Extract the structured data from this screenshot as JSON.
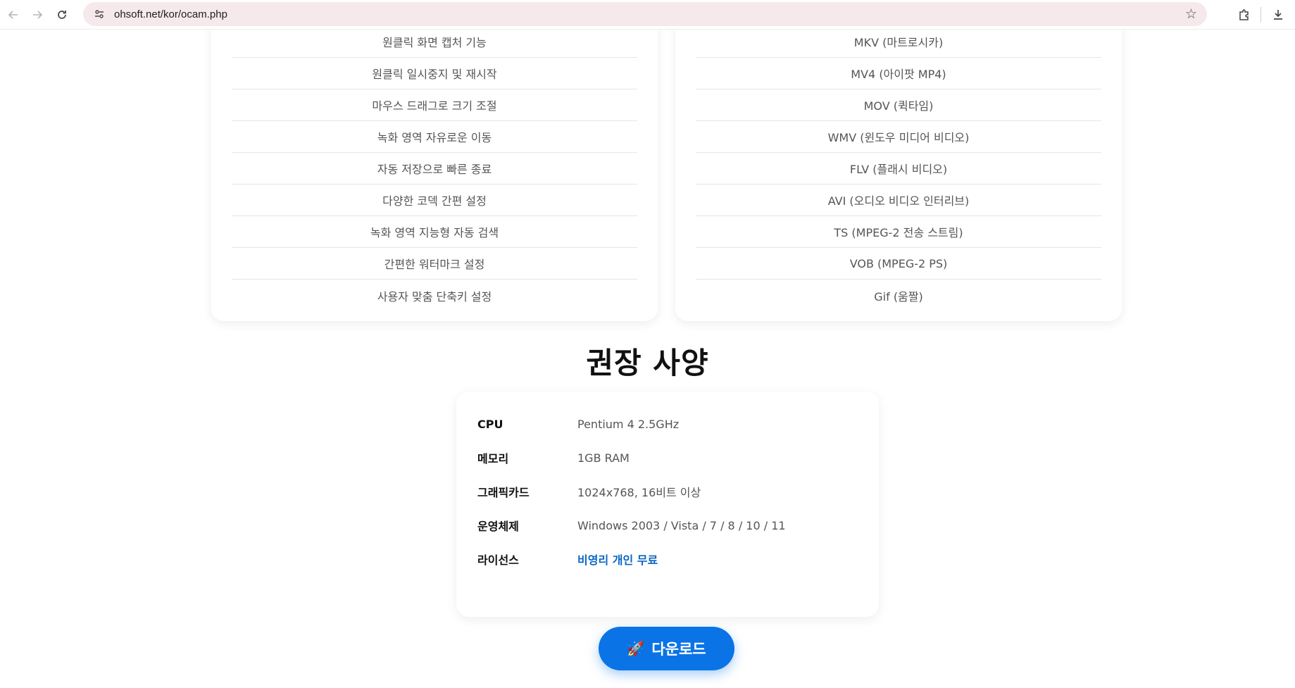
{
  "browser": {
    "url": "ohsoft.net/kor/ocam.php"
  },
  "features": {
    "items": [
      "원클릭 화면 캡처 기능",
      "원클릭 일시중지 및 재시작",
      "마우스 드래그로 크기 조절",
      "녹화 영역 자유로운 이동",
      "자동 저장으로 빠른 종료",
      "다양한 코덱 간편 설정",
      "녹화 영역 지능형 자동 검색",
      "간편한 워터마크 설정",
      "사용자 맞춤 단축키 설정"
    ]
  },
  "formats": {
    "items": [
      "MKV (마트로시카)",
      "MV4 (아이팟 MP4)",
      "MOV (퀵타임)",
      "WMV (윈도우 미디어 비디오)",
      "FLV (플래시 비디오)",
      "AVI (오디오 비디오 인터리브)",
      "TS (MPEG-2 전송 스트림)",
      "VOB (MPEG-2 PS)",
      "Gif (움짤)"
    ]
  },
  "requirements": {
    "title": "권장 사양",
    "rows": [
      {
        "key": "CPU",
        "value": "Pentium 4 2.5GHz"
      },
      {
        "key": "메모리",
        "value": "1GB RAM"
      },
      {
        "key": "그래픽카드",
        "value": "1024x768, 16비트 이상"
      },
      {
        "key": "운영체제",
        "value": "Windows 2003 / Vista / 7 / 8 / 10 / 11"
      },
      {
        "key": "라이선스",
        "value": "비영리 개인 무료"
      }
    ]
  },
  "download": {
    "icon": "🚀",
    "label": "다운로드"
  },
  "colors": {
    "accent": "#0a74e6",
    "link": "#0a66c2",
    "omnibox": "#f6e9ec"
  }
}
